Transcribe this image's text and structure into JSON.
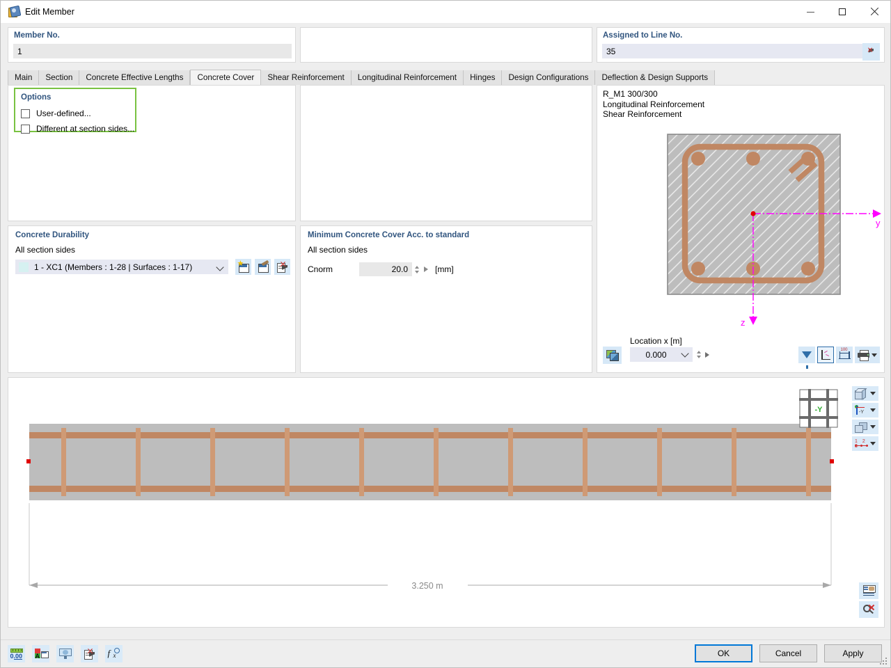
{
  "window": {
    "title": "Edit Member",
    "icon": "member-icon",
    "minimize": "minimize-icon",
    "maximize": "maximize-icon",
    "close": "close-icon"
  },
  "header": {
    "member_no_label": "Member No.",
    "member_no_value": "1",
    "assigned_line_label": "Assigned to Line No.",
    "assigned_line_value": "35",
    "pick_icon": "select-cursor-icon"
  },
  "tabs": [
    {
      "label": "Main",
      "active": false
    },
    {
      "label": "Section",
      "active": false
    },
    {
      "label": "Concrete Effective Lengths",
      "active": false
    },
    {
      "label": "Concrete Cover",
      "active": true
    },
    {
      "label": "Shear Reinforcement",
      "active": false
    },
    {
      "label": "Longitudinal Reinforcement",
      "active": false
    },
    {
      "label": "Hinges",
      "active": false
    },
    {
      "label": "Design Configurations",
      "active": false
    },
    {
      "label": "Deflection & Design Supports",
      "active": false
    }
  ],
  "options": {
    "title": "Options",
    "highlight_color": "#79c241",
    "checkboxes": [
      {
        "label": "User-defined...",
        "checked": false
      },
      {
        "label": "Different at section sides...",
        "checked": false
      }
    ]
  },
  "concrete_durability": {
    "title": "Concrete Durability",
    "sublabel": "All section sides",
    "selected": "1 - XC1 (Members : 1-28 | Surfaces : 1-17)",
    "swatch_color": "#d6f1f1",
    "buttons": [
      {
        "name": "new-durability-icon",
        "tip": "New"
      },
      {
        "name": "edit-durability-icon",
        "tip": "Edit"
      },
      {
        "name": "delete-durability-icon",
        "tip": "Delete"
      }
    ]
  },
  "minimum_cover": {
    "title": "Minimum Concrete Cover Acc. to standard",
    "sublabel": "All section sides",
    "field_label": "Cnorm",
    "field_value": "20.0",
    "unit": "[mm]"
  },
  "section_view": {
    "info_lines": "R_M1 300/300\nLongitudinal Reinforcement\nShear Reinforcement",
    "section_name": "R_M1 300/300",
    "axis_y_label": "y",
    "axis_z_label": "z",
    "axis_color": "#ff00ff",
    "concrete_color": "#bdbdbd",
    "rebar_color": "#c08763",
    "location_label": "Location x [m]",
    "location_value": "0.000",
    "snapshot_icon": "snapshot-icon",
    "tools": [
      {
        "name": "filter-icon"
      },
      {
        "name": "axes-display-icon",
        "selected": true
      },
      {
        "name": "dimensions-icon"
      },
      {
        "name": "print-icon"
      }
    ]
  },
  "member_view": {
    "dimension_label": "3.250 m",
    "concrete_color": "#bdbdbd",
    "rebar_color": "#c08763",
    "node_color": "#e00000",
    "stirrup_count": 12,
    "view_tools": [
      {
        "name": "render-mode-icon"
      },
      {
        "name": "view-direction-icon",
        "axis_label": "-Y"
      },
      {
        "name": "solid-model-icon"
      },
      {
        "name": "numbering-icon",
        "digits": "1 2 3"
      }
    ],
    "corner_tools": [
      {
        "name": "report-icon"
      },
      {
        "name": "zoom-reset-icon"
      }
    ],
    "nav_cube": "navigation-cube-icon"
  },
  "statusbar": {
    "left_buttons": [
      {
        "name": "units-decimals-icon",
        "label": "0.00"
      },
      {
        "name": "display-properties-icon"
      },
      {
        "name": "visual-object-icon"
      },
      {
        "name": "delete-selection-icon"
      },
      {
        "name": "formula-icon"
      }
    ],
    "ok_label": "OK",
    "cancel_label": "Cancel",
    "apply_label": "Apply"
  }
}
